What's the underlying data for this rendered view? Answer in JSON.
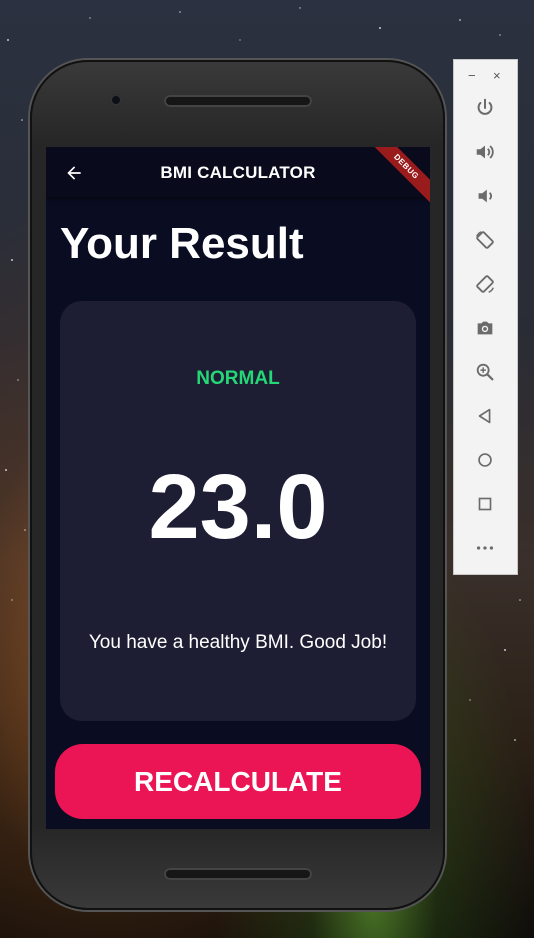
{
  "app": {
    "title": "BMI CALCULATOR",
    "debug_label": "DEBUG"
  },
  "result": {
    "heading": "Your Result",
    "status": "NORMAL",
    "bmi": "23.0",
    "interpretation": "You have a healthy BMI. Good Job!",
    "button_label": "RECALCULATE"
  },
  "emulator_toolbar": {
    "minimize": "−",
    "close": "×",
    "tools": [
      "power-icon",
      "volume-up-icon",
      "volume-down-icon",
      "rotate-left-icon",
      "rotate-right-icon",
      "camera-icon",
      "zoom-icon",
      "back-icon",
      "home-icon",
      "overview-icon",
      "more-icon"
    ]
  },
  "colors": {
    "screen_bg": "#0a0d22",
    "card_bg": "#1d1e33",
    "status": "#24d876",
    "accent": "#eb1555",
    "toolbar_icon": "#6b6b6b"
  }
}
